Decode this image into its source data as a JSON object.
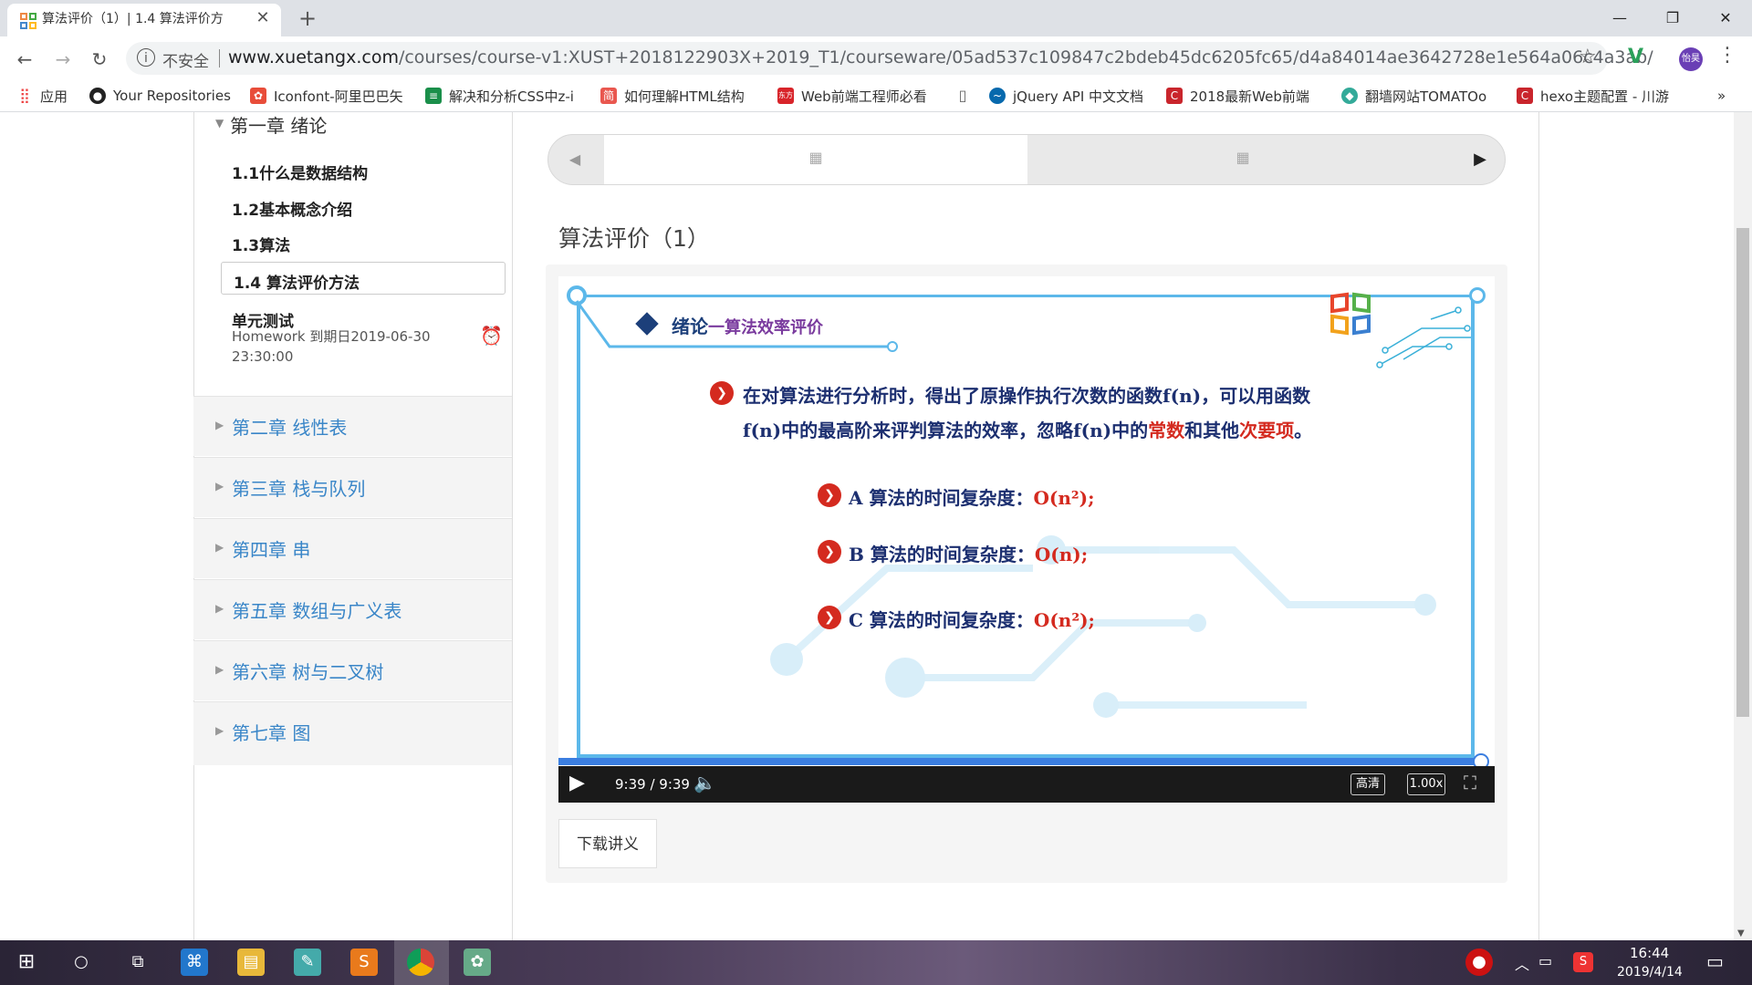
{
  "browser": {
    "tab_title": "算法评价（1）| 1.4 算法评价方",
    "tab_close": "✕",
    "new_tab": "+",
    "window_controls": {
      "minimize": "—",
      "maximize": "❐",
      "close": "✕"
    },
    "nav": {
      "back": "←",
      "forward": "→",
      "reload": "↻"
    },
    "security_label": "不安全",
    "url_host": "www.xuetangx.com",
    "url_path": "/courses/course-v1:XUST+2018122903X+2019_T1/courseware/05ad537c109847c2bdeb45dc6205fc65/d4a84014ae3642728e1e564a06c4a3ab/",
    "profile_initials": "怡昊",
    "bookmarks": [
      {
        "label": "应用",
        "icon": "apps-icon",
        "color": "#e44"
      },
      {
        "label": "Your Repositories",
        "icon": "github-icon",
        "color": "#222"
      },
      {
        "label": "Iconfont-阿里巴巴矢",
        "icon": "iconfont-icon",
        "color": "#e84d3a"
      },
      {
        "label": "解决和分析CSS中z-i",
        "icon": "doc-icon",
        "color": "#1a8f4a"
      },
      {
        "label": "如何理解HTML结构",
        "icon": "jianshu-icon",
        "color": "#e9574f"
      },
      {
        "label": "Web前端工程师必看",
        "icon": "dongfang-icon",
        "color": "#d8242a"
      },
      {
        "label": "jQuery API 中文文档",
        "icon": "jquery-icon",
        "color": "#0769ad"
      },
      {
        "label": "2018最新Web前端",
        "icon": "csdn-icon",
        "color": "#c9252c"
      },
      {
        "label": "翻墙网站TOMATOo",
        "icon": "tomato-icon",
        "color": "#3a9"
      },
      {
        "label": "hexo主题配置 - 川游",
        "icon": "csdn-icon",
        "color": "#c9252c"
      }
    ],
    "bookmark_more": "»"
  },
  "sidebar": {
    "chapter1": "第一章 绪论",
    "lessons": [
      "1.1什么是数据结构",
      "1.2基本概念介绍",
      "1.3算法",
      "1.4 算法评价方法"
    ],
    "unit_test_title": "单元测试",
    "unit_test_desc": "Homework 到期日2019-06-30 23:30:00",
    "chapters": [
      "第二章 线性表",
      "第三章 栈与队列",
      "第四章 串",
      "第五章 数组与广义表",
      "第六章 树与二叉树",
      "第七章 图"
    ]
  },
  "main": {
    "lesson_heading": "算法评价（1）",
    "video": {
      "slide_title": "绪论",
      "slide_subtitle": "一算法效率评价",
      "para1_a": "在对算法进行分析时，得出了原操作执行次数的函数f(n)，可以用函数",
      "para1_b_pre": "f(n)中的最高阶来评判算法的效率，忽略f(n)中的",
      "para1_hl1": "常数",
      "para1_mid": "和其他",
      "para1_hl2": "次要项",
      "para1_end": "。",
      "item_a": "A 算法的时间复杂度：",
      "item_a_val": "O(n²);",
      "item_b": "B 算法的时间复杂度：",
      "item_b_val": "O(n);",
      "item_c": "C 算法的时间复杂度：",
      "item_c_val": "O(n²);",
      "time": "9:39 / 9:39",
      "progress": 1.0,
      "quality": "高清",
      "speed": "1.00x"
    },
    "download_label": "下载讲义"
  },
  "taskbar": {
    "time": "16:44",
    "date": "2019/4/14"
  }
}
